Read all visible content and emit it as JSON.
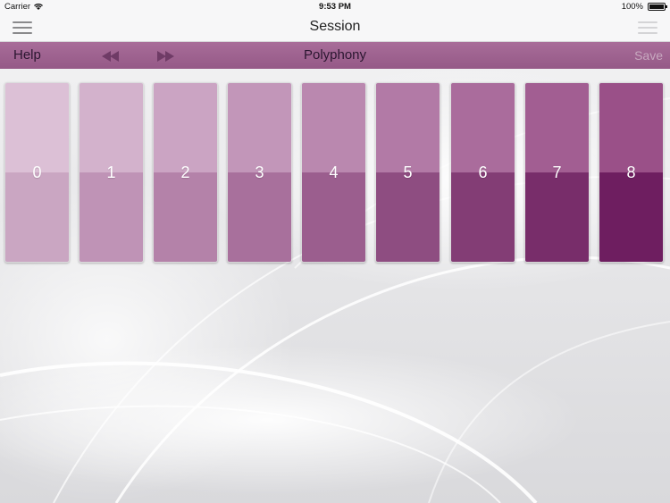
{
  "status_bar": {
    "carrier": "Carrier",
    "time": "9:53 PM",
    "battery_percent": "100%"
  },
  "nav_bar": {
    "title": "Session",
    "left_icon": "menu-icon",
    "right_icon": "menu-icon"
  },
  "toolbar": {
    "help_label": "Help",
    "title": "Polyphony",
    "save_label": "Save",
    "prev_icon": "rewind-icon",
    "next_icon": "fast-forward-icon",
    "accent_color": "#9b5f8d"
  },
  "pads": [
    {
      "label": "0",
      "top_color": "#dcc0d6",
      "bottom_color": "#caa6c2"
    },
    {
      "label": "1",
      "top_color": "#d3b2cc",
      "bottom_color": "#bf93b6"
    },
    {
      "label": "2",
      "top_color": "#cba4c3",
      "bottom_color": "#b482a9"
    },
    {
      "label": "3",
      "top_color": "#c296b9",
      "bottom_color": "#a8709c"
    },
    {
      "label": "4",
      "top_color": "#ba88af",
      "bottom_color": "#9b5e8e"
    },
    {
      "label": "5",
      "top_color": "#b27aa6",
      "bottom_color": "#8e4d81"
    },
    {
      "label": "6",
      "top_color": "#aa6c9c",
      "bottom_color": "#833d75"
    },
    {
      "label": "7",
      "top_color": "#a25e92",
      "bottom_color": "#782d6a"
    },
    {
      "label": "8",
      "top_color": "#9a5088",
      "bottom_color": "#6e1e60"
    }
  ]
}
